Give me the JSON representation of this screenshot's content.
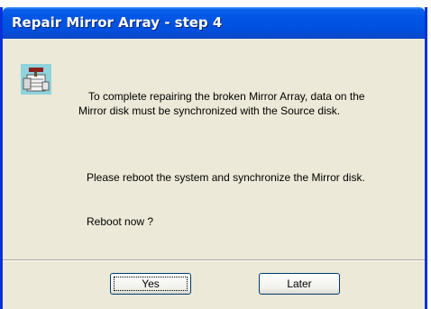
{
  "dialog": {
    "title": "Repair Mirror Array - step 4",
    "message_line1": "To complete repairing the broken Mirror Array, data on the",
    "message_line2": "Mirror disk must be synchronized with the Source disk.",
    "instruction": "Please reboot the system and synchronize the Mirror disk.",
    "question": "Reboot now ?",
    "icon": "disk-repair-icon"
  },
  "buttons": {
    "yes_label": "Yes",
    "later_label": "Later"
  },
  "colors": {
    "titlebar": "#0054e3",
    "window_body": "#ece9d8",
    "title_text": "#ffffff"
  }
}
